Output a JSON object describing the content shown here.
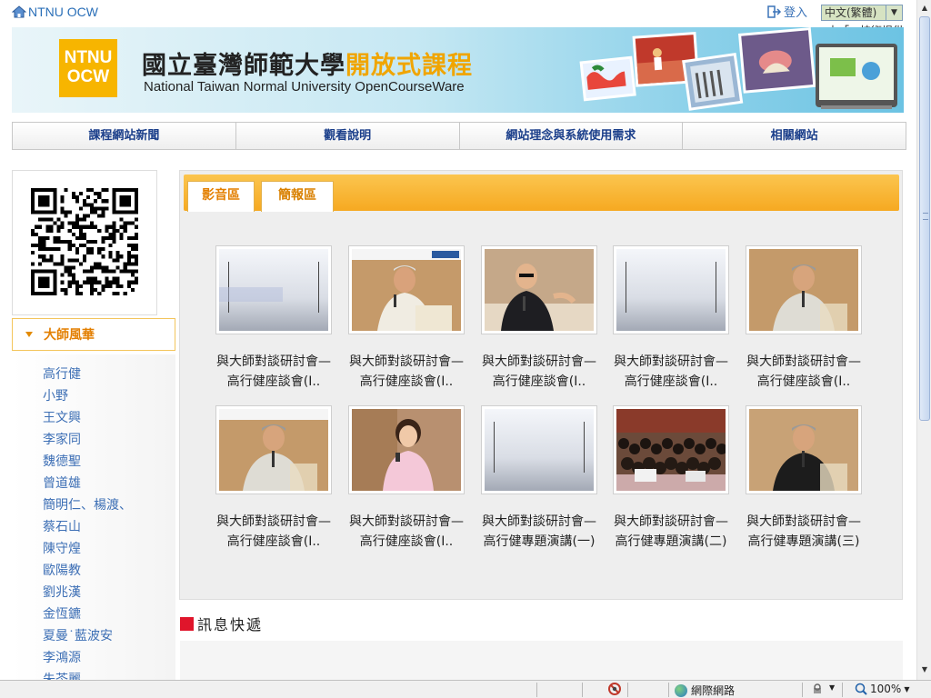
{
  "header": {
    "site_name": "NTNU OCW",
    "login_label": "登入",
    "language_value": "中文(繁體)",
    "tech_credit": "由「」技術提供"
  },
  "banner": {
    "logo_line1": "NTNU",
    "logo_line2": "OCW",
    "title_main": "國立臺灣師範大學",
    "title_accent": "開放式課程",
    "subtitle": "National Taiwan Normal University OpenCourseWare"
  },
  "nav": {
    "items": [
      "課程網站新聞",
      "觀看說明",
      "網站理念與系統使用需求",
      "相關網站"
    ]
  },
  "sidebar": {
    "section_title": "大師風華",
    "items": [
      "高行健",
      "小野",
      "王文興",
      "李家同",
      "魏德聖",
      "曾道雄",
      "簡明仁、楊渡、",
      "蔡石山",
      "陳守煌",
      "歐陽教",
      "劉兆漢",
      "金恆鑣",
      "夏曼˙藍波安",
      "李鴻源",
      "朱苓麗"
    ]
  },
  "tabs": {
    "video": "影音區",
    "slides": "簡報區"
  },
  "videos": [
    {
      "line1": "與大師對談研討會—",
      "line2": "高行健座談會(I..",
      "thumb": "blank-title"
    },
    {
      "line1": "與大師對談研討會—",
      "line2": "高行健座談會(I..",
      "thumb": "man-white-shirt"
    },
    {
      "line1": "與大師對談研討會—",
      "line2": "高行健座談會(I..",
      "thumb": "man-glasses"
    },
    {
      "line1": "與大師對談研討會—",
      "line2": "高行健座談會(I..",
      "thumb": "blank"
    },
    {
      "line1": "與大師對談研討會—",
      "line2": "高行健座談會(I..",
      "thumb": "elder-speaker"
    },
    {
      "line1": "與大師對談研討會—",
      "line2": "高行健座談會(I..",
      "thumb": "elder-close"
    },
    {
      "line1": "與大師對談研討會—",
      "line2": "高行健座談會(I..",
      "thumb": "woman-pink"
    },
    {
      "line1": "與大師對談研討會—",
      "line2": "高行健專題演講(一)",
      "thumb": "blank"
    },
    {
      "line1": "與大師對談研討會—",
      "line2": "高行健專題演講(二)",
      "thumb": "audience"
    },
    {
      "line1": "與大師對談研討會—",
      "line2": "高行健專題演講(三)",
      "thumb": "elder-dark"
    }
  ],
  "news": {
    "title": "訊息快遞"
  },
  "statusbar": {
    "zone": "網際網路",
    "zoom": "100%"
  },
  "colors": {
    "accent_orange": "#f6a921",
    "link_blue": "#3d6fb5",
    "nav_text": "#1a3e8a",
    "news_marker": "#e0152b"
  }
}
